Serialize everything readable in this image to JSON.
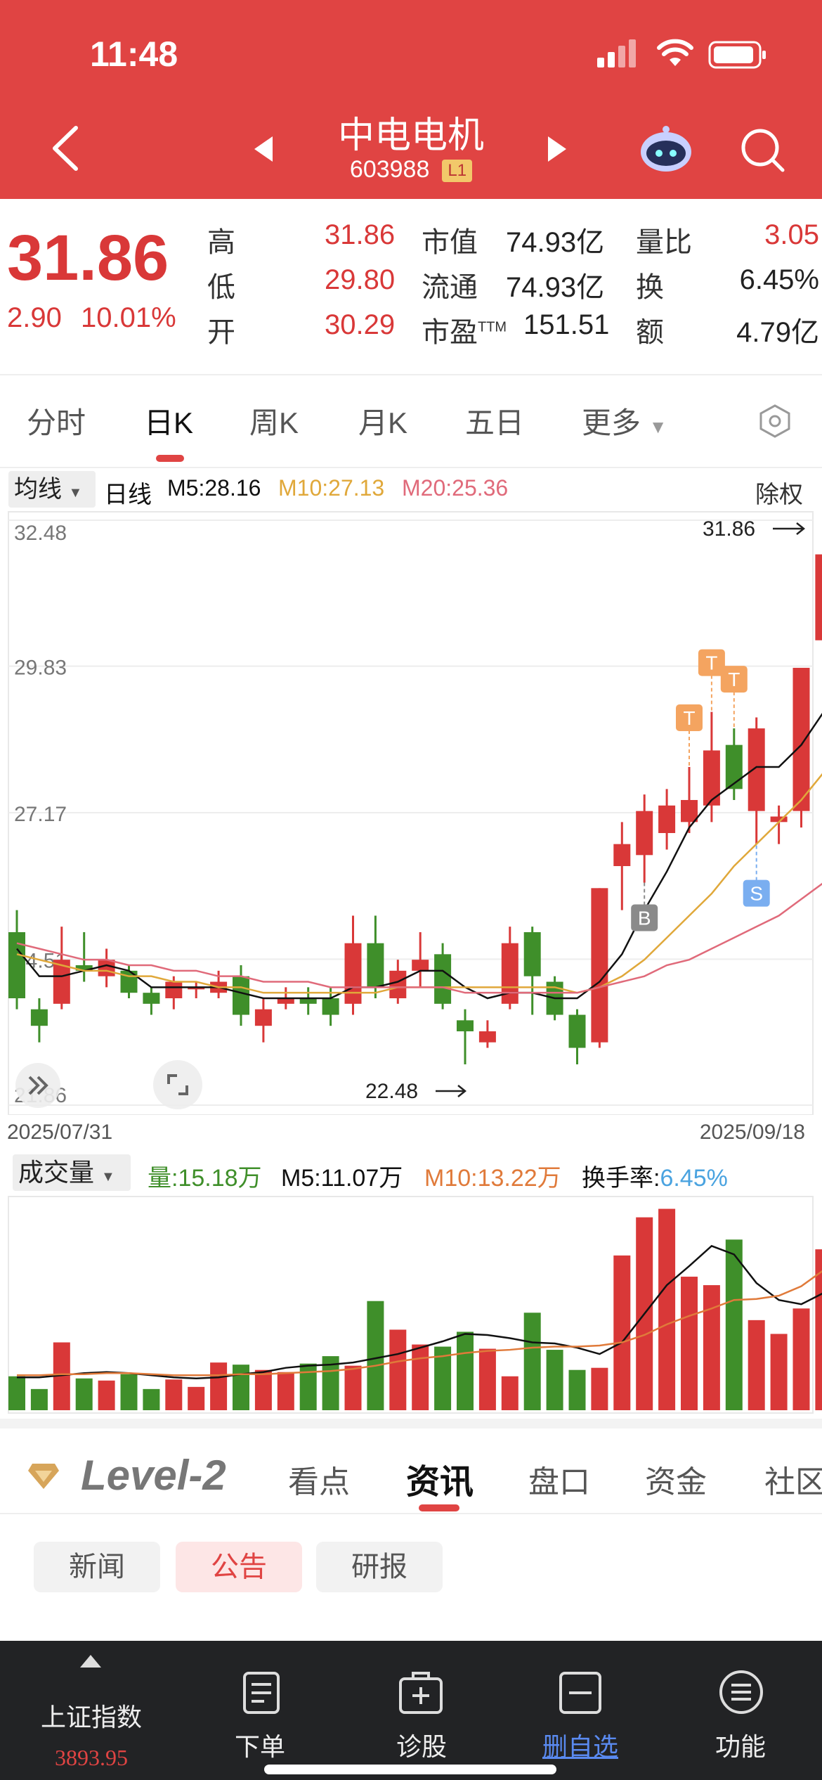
{
  "status": {
    "time": "11:48"
  },
  "header": {
    "title": "中电电机",
    "code": "603988",
    "code_badge": "L1"
  },
  "quote": {
    "price": "31.86",
    "change": "2.90",
    "change_pct": "10.01%",
    "high_label": "高",
    "high": "31.86",
    "low_label": "低",
    "low": "29.80",
    "open_label": "开",
    "open": "30.29",
    "mcap_label": "市值",
    "mcap": "74.93亿",
    "float_label": "流通",
    "float": "74.93亿",
    "pe_label": "市盈",
    "pe_sup": "TTM",
    "pe": "151.51",
    "vr_label": "量比",
    "vr": "3.05",
    "turn_label": "换",
    "turn": "6.45%",
    "amt_label": "额",
    "amt": "4.79亿"
  },
  "tabs": [
    "分时",
    "日K",
    "周K",
    "月K",
    "五日",
    "更多"
  ],
  "ma_bar": {
    "dropdown": "均线",
    "label": "日线",
    "m5": "M5:28.16",
    "m10": "M10:27.13",
    "m20": "M20:25.36",
    "right": "除权"
  },
  "colors": {
    "up": "#d93838",
    "down": "#3f8f2a",
    "m5": "#111111",
    "m10": "#e0a83a",
    "m20": "#e06a7a",
    "header": "#e04443"
  },
  "chart_data": {
    "type": "candlestick",
    "axis": {
      "y_ticks": [
        "32.48",
        "29.83",
        "27.17",
        "24.51",
        "21.86"
      ],
      "ylim": [
        21.86,
        32.48
      ]
    },
    "date_start": "2025/07/31",
    "date_end": "2025/09/18",
    "max_label": "31.86",
    "min_label": "22.48",
    "ohlc": [
      [
        25.0,
        23.8,
        25.4,
        23.6
      ],
      [
        23.6,
        23.3,
        23.8,
        23.0
      ],
      [
        23.7,
        24.5,
        25.1,
        23.6
      ],
      [
        24.4,
        24.3,
        25.0,
        24.1
      ],
      [
        24.2,
        24.5,
        24.7,
        24.0
      ],
      [
        24.3,
        23.9,
        24.4,
        23.8
      ],
      [
        23.9,
        23.7,
        24.0,
        23.5
      ],
      [
        23.8,
        24.1,
        24.2,
        23.6
      ],
      [
        24.0,
        24.0,
        24.1,
        23.8
      ],
      [
        23.9,
        24.1,
        24.3,
        23.8
      ],
      [
        24.2,
        23.5,
        24.4,
        23.3
      ],
      [
        23.3,
        23.6,
        23.8,
        23.0
      ],
      [
        23.7,
        23.8,
        24.0,
        23.6
      ],
      [
        23.8,
        23.7,
        24.0,
        23.5
      ],
      [
        23.8,
        23.5,
        24.0,
        23.3
      ],
      [
        23.7,
        24.8,
        25.3,
        23.5
      ],
      [
        24.8,
        24.0,
        25.3,
        23.8
      ],
      [
        23.8,
        24.3,
        24.5,
        23.7
      ],
      [
        24.3,
        24.5,
        25.0,
        24.0
      ],
      [
        24.6,
        23.7,
        24.8,
        23.6
      ],
      [
        23.4,
        23.2,
        23.6,
        22.6
      ],
      [
        23.0,
        23.2,
        23.4,
        22.9
      ],
      [
        23.7,
        24.8,
        25.1,
        23.6
      ],
      [
        25.0,
        24.2,
        25.1,
        23.5
      ],
      [
        24.1,
        23.5,
        24.2,
        23.4
      ],
      [
        23.5,
        22.9,
        23.6,
        22.6
      ],
      [
        23.0,
        25.8,
        25.8,
        22.9
      ],
      [
        26.2,
        26.6,
        27.0,
        25.4
      ],
      [
        26.4,
        27.2,
        27.5,
        25.9
      ],
      [
        26.8,
        27.3,
        27.6,
        26.5
      ],
      [
        27.0,
        27.4,
        28.0,
        26.8
      ],
      [
        27.3,
        28.3,
        29.0,
        27.0
      ],
      [
        28.4,
        27.6,
        28.7,
        27.4
      ],
      [
        27.2,
        28.7,
        28.9,
        26.6
      ],
      [
        27.0,
        27.1,
        27.3,
        26.6
      ],
      [
        27.2,
        29.8,
        29.8,
        26.9
      ],
      [
        30.3,
        31.86,
        31.86,
        29.8
      ]
    ],
    "ma5": [
      24.7,
      24.2,
      24.2,
      24.3,
      24.4,
      24.3,
      24.0,
      24.0,
      24.0,
      24.0,
      23.9,
      23.8,
      23.8,
      23.8,
      23.8,
      24.0,
      24.0,
      24.1,
      24.3,
      24.3,
      24.0,
      23.8,
      23.9,
      23.9,
      23.8,
      23.8,
      24.1,
      24.6,
      25.4,
      26.1,
      26.9,
      27.4,
      27.7,
      28.0,
      28.0,
      28.4,
      29.0
    ],
    "ma10": [
      24.6,
      24.5,
      24.4,
      24.3,
      24.3,
      24.2,
      24.2,
      24.1,
      24.1,
      24.0,
      24.0,
      23.9,
      23.9,
      23.9,
      23.9,
      23.9,
      23.9,
      24.0,
      24.0,
      24.0,
      24.0,
      24.0,
      24.0,
      24.0,
      24.0,
      23.9,
      24.0,
      24.2,
      24.5,
      24.9,
      25.3,
      25.7,
      26.2,
      26.6,
      27.0,
      27.4,
      27.9
    ],
    "ma20": [
      24.8,
      24.7,
      24.6,
      24.5,
      24.5,
      24.4,
      24.4,
      24.3,
      24.3,
      24.2,
      24.2,
      24.1,
      24.1,
      24.1,
      24.0,
      24.0,
      24.0,
      24.0,
      24.0,
      24.0,
      23.9,
      23.9,
      23.9,
      23.9,
      23.9,
      23.9,
      24.0,
      24.1,
      24.2,
      24.4,
      24.5,
      24.7,
      24.9,
      25.1,
      25.3,
      25.6,
      25.9
    ],
    "markers": [
      {
        "index": 28,
        "text": "B"
      },
      {
        "index": 30,
        "text": "T"
      },
      {
        "index": 31,
        "text": "T"
      },
      {
        "index": 32,
        "text": "T"
      },
      {
        "index": 33,
        "text": "S"
      }
    ],
    "volume": [
      3.2,
      2.0,
      6.4,
      3.0,
      2.8,
      3.4,
      2.0,
      2.9,
      2.2,
      4.5,
      4.3,
      3.8,
      3.6,
      4.4,
      5.1,
      4.2,
      10.3,
      7.6,
      6.2,
      6.0,
      7.4,
      5.8,
      3.2,
      9.2,
      5.7,
      3.8,
      4.0,
      14.6,
      18.2,
      19.0,
      12.6,
      11.8,
      16.1,
      8.5,
      7.2,
      9.6,
      15.18
    ],
    "vol_ma5": [
      3.1,
      3.1,
      3.3,
      3.5,
      3.6,
      3.5,
      3.3,
      3.1,
      3.0,
      3.1,
      3.4,
      3.6,
      4.0,
      4.2,
      4.3,
      4.5,
      4.9,
      5.3,
      5.9,
      6.5,
      7.2,
      7.1,
      6.8,
      6.4,
      6.3,
      5.9,
      5.3,
      6.4,
      9.1,
      11.8,
      13.6,
      15.5,
      14.7,
      12.0,
      10.4,
      10.0,
      11.07
    ],
    "vol_ma10": [
      3.3,
      3.3,
      3.4,
      3.4,
      3.5,
      3.5,
      3.4,
      3.3,
      3.3,
      3.3,
      3.4,
      3.4,
      3.5,
      3.6,
      3.7,
      3.9,
      4.2,
      4.6,
      4.9,
      5.1,
      5.4,
      5.6,
      5.7,
      5.9,
      6.0,
      6.0,
      6.1,
      6.4,
      7.1,
      8.1,
      8.9,
      9.6,
      10.4,
      10.5,
      10.8,
      11.7,
      13.22
    ]
  },
  "volume_bar": {
    "dropdown": "成交量",
    "vol": "量:15.18万",
    "m5": "M5:11.07万",
    "m10": "M10:13.22万",
    "turn_label": "换手率:",
    "turn": "6.45%"
  },
  "info_tabs": {
    "brand": "Level-2",
    "items": [
      "看点",
      "资讯",
      "盘口",
      "资金",
      "社区"
    ]
  },
  "chips": [
    "新闻",
    "公告",
    "研报"
  ],
  "bottom": {
    "index_name": "上证指数",
    "index_value": "3893.95",
    "items": [
      "下单",
      "诊股",
      "删自选",
      "功能"
    ]
  }
}
